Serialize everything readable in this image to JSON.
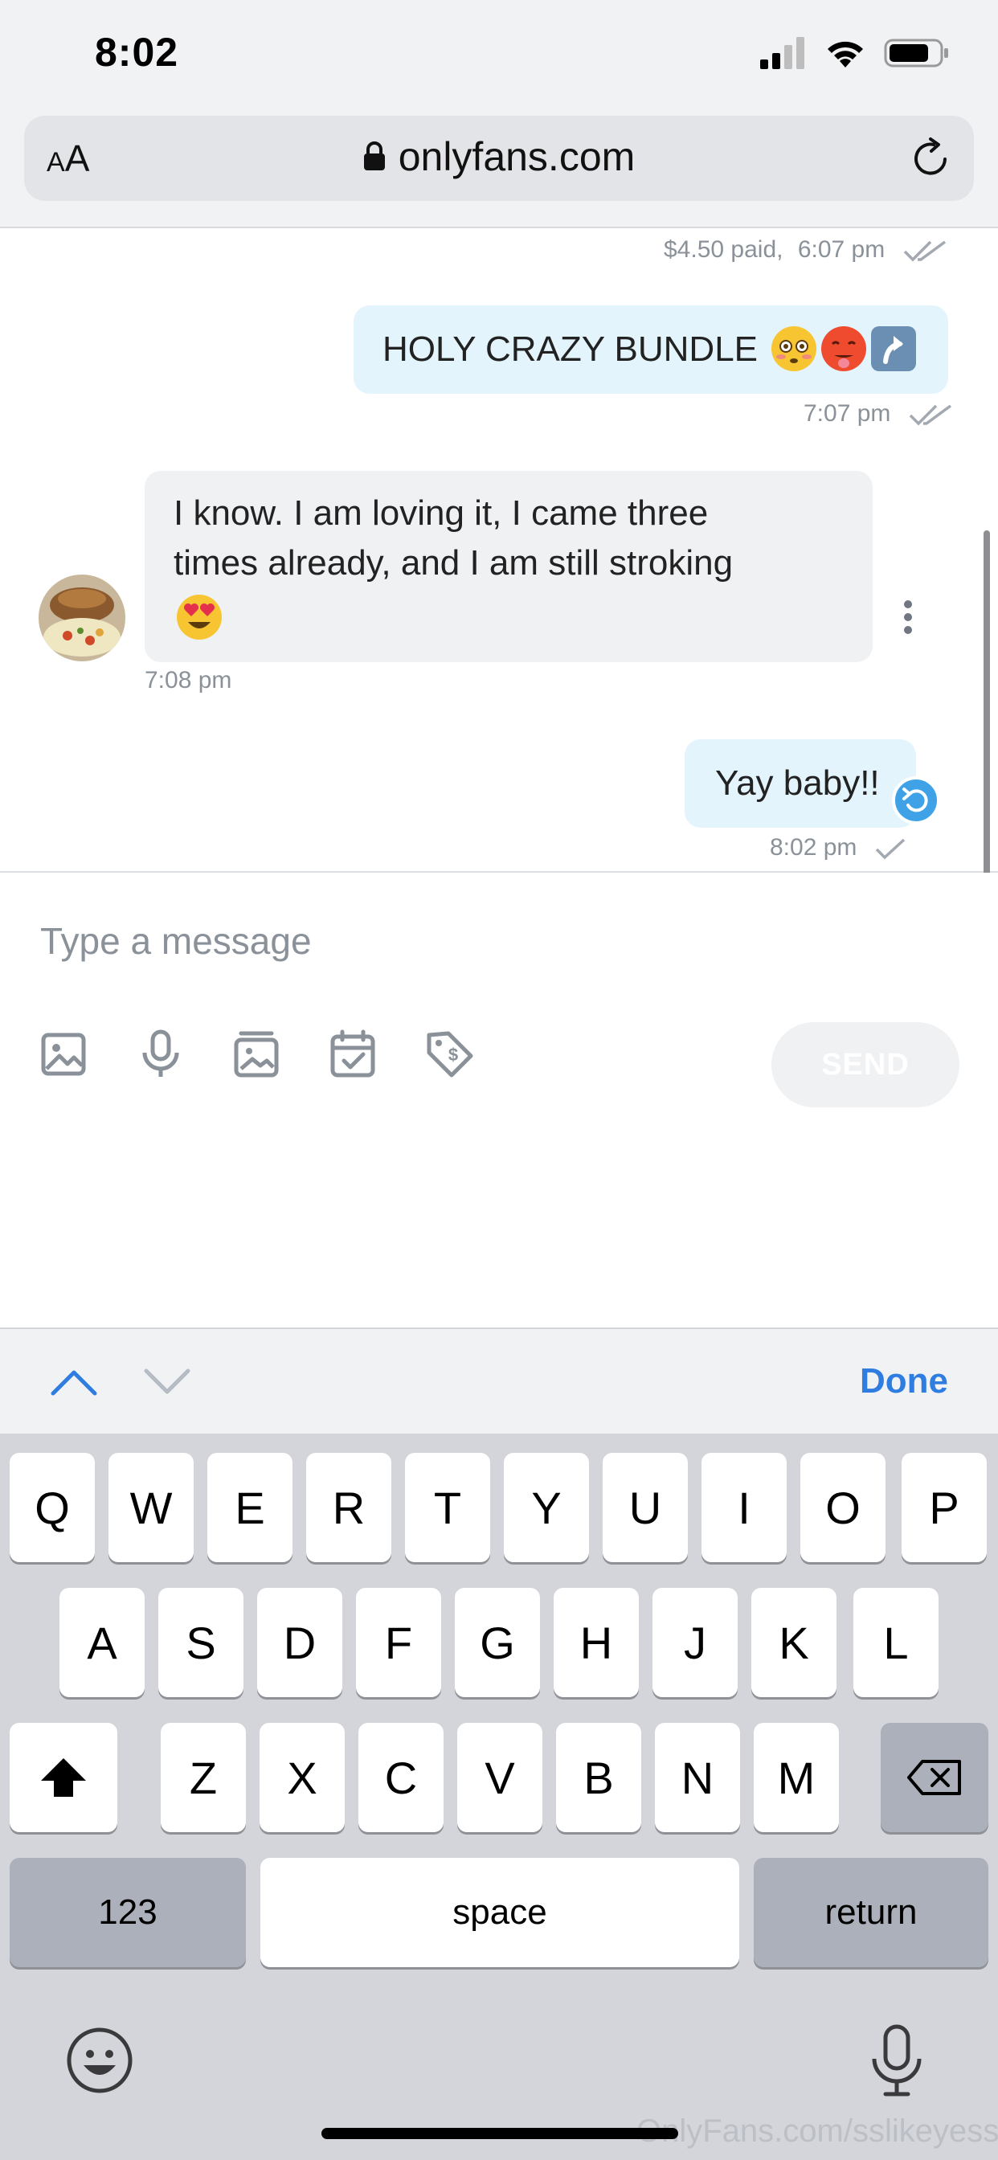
{
  "status_bar": {
    "time": "8:02"
  },
  "browser": {
    "aa_small": "A",
    "aa_large": "A",
    "url": "onlyfans.com"
  },
  "messages": [
    {
      "direction": "out",
      "price": "$4.50 paid,",
      "time": "6:07 pm",
      "status": "read"
    },
    {
      "direction": "out",
      "text": "HOLY CRAZY BUNDLE",
      "emojis": [
        "flushed-face",
        "hot-face",
        "up-arrow"
      ],
      "time": "7:07 pm",
      "status": "read"
    },
    {
      "direction": "in",
      "line1": "I know. I am loving it, I came three",
      "line2": "times already, and I am still stroking",
      "emojis": [
        "heart-eyes-face"
      ],
      "time": "7:08 pm"
    },
    {
      "direction": "out",
      "text": "Yay baby!!",
      "time": "8:02 pm",
      "status": "sent"
    }
  ],
  "composer": {
    "placeholder": "Type a message",
    "send_label": "SEND",
    "tools": [
      "image-icon",
      "microphone-icon",
      "media-vault-icon",
      "calendar-check-icon",
      "price-tag-icon"
    ]
  },
  "accessory": {
    "done_label": "Done"
  },
  "keyboard": {
    "row1": [
      "Q",
      "W",
      "E",
      "R",
      "T",
      "Y",
      "U",
      "I",
      "O",
      "P"
    ],
    "row2": [
      "A",
      "S",
      "D",
      "F",
      "G",
      "H",
      "J",
      "K",
      "L"
    ],
    "row3": [
      "Z",
      "X",
      "C",
      "V",
      "B",
      "N",
      "M"
    ],
    "numbers_label": "123",
    "space_label": "space",
    "return_label": "return"
  },
  "watermark": "OnlyFans.com/sslikeyesss",
  "colors": {
    "accent": "#2f7de1",
    "outgoing_bubble": "#e4f4fd",
    "incoming_bubble": "#f0f1f3",
    "undo_badge": "#3fa2e6"
  }
}
